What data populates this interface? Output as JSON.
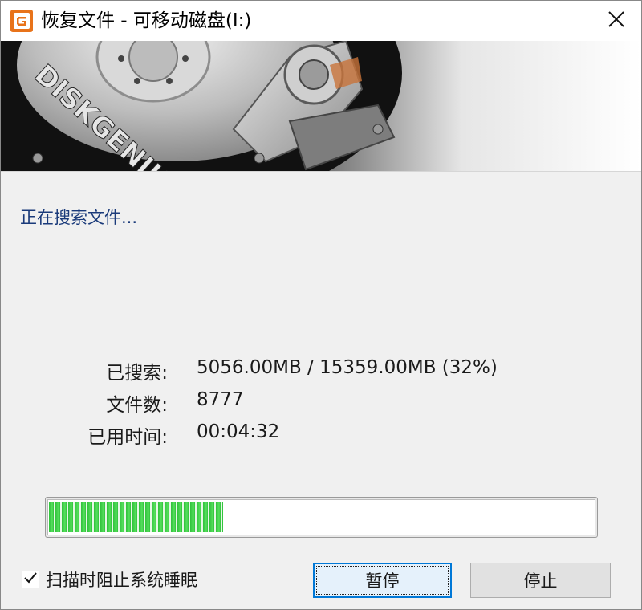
{
  "window": {
    "title": "恢复文件 - 可移动磁盘(I:)",
    "close_glyph": "✕"
  },
  "banner": {
    "brand_text": "DISKGENIUS"
  },
  "status": {
    "text": "正在搜索文件..."
  },
  "stats": [
    {
      "label": "已搜索:",
      "value": "5056.00MB / 15359.00MB (32%)"
    },
    {
      "label": "文件数:",
      "value": "8777"
    },
    {
      "label": "已用时间:",
      "value": "00:04:32"
    }
  ],
  "progress": {
    "fraction": 0.32,
    "fill_color": "#36c83f"
  },
  "options": {
    "prevent_sleep_label": "扫描时阻止系统睡眠",
    "prevent_sleep_checked": true
  },
  "buttons": {
    "pause_label": "暂停",
    "stop_label": "停止"
  },
  "colors": {
    "accent": "#0078d7",
    "status_text": "#1a3a7a",
    "app_icon": "#e8731a"
  }
}
